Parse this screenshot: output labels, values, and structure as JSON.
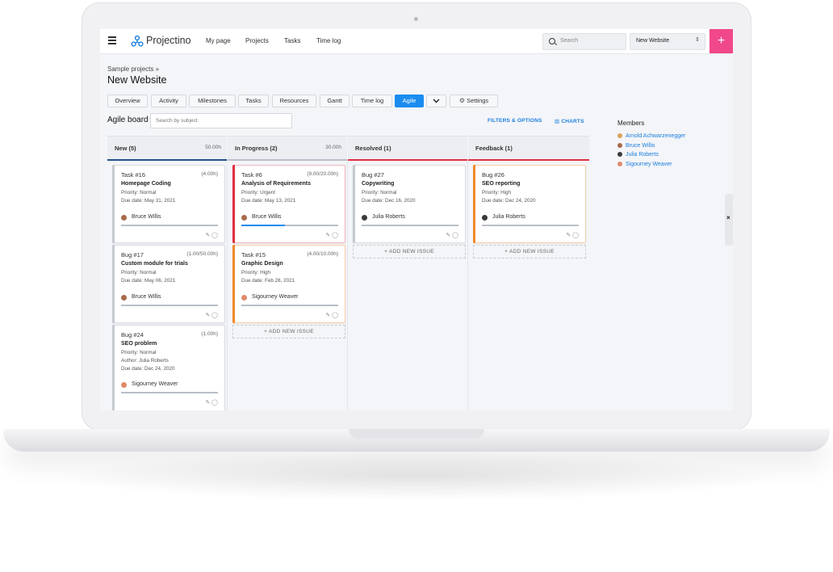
{
  "app": {
    "name": "Projectino"
  },
  "nav": [
    "My page",
    "Projects",
    "Tasks",
    "Time log"
  ],
  "search": {
    "placeholder": "Search"
  },
  "project_select": {
    "value": "New Website"
  },
  "breadcrumb": "Sample projects »",
  "page_title": "New Website",
  "tabs": [
    "Overview",
    "Activity",
    "Milestones",
    "Tasks",
    "Resources",
    "Gantt",
    "Time log",
    "Agile"
  ],
  "settings_label": "Settings",
  "agile": {
    "title": "Agile board",
    "search_placeholder": "Search by subject",
    "filters_label": "FILTERS & OPTIONS",
    "charts_label": "CHARTS",
    "add_new_label": "+ ADD NEW ISSUE"
  },
  "columns": [
    {
      "name": "New (5)",
      "hours": "50.00h",
      "accent": "#1f4f8a"
    },
    {
      "name": "In Progress (2)",
      "hours": "30.00h",
      "accent": "#b9bec8"
    },
    {
      "name": "Resolved (1)",
      "hours": "",
      "accent": "#e02f44"
    },
    {
      "name": "Feedback (1)",
      "hours": "",
      "accent": "#e02f44"
    }
  ],
  "cards": {
    "c16": {
      "title": "Task #16",
      "est": "(4.00h)",
      "subject": "Homepage Coding",
      "line1": "Priority: Normal",
      "line2": "Due date: May 31, 2021",
      "assignee": "Bruce Willis"
    },
    "c17": {
      "title": "Bug #17",
      "est": "(1.00/50.00h)",
      "subject": "Custom module for trials",
      "line1": "Priority: Normal",
      "line2": "Due date: May 06, 2021",
      "assignee": "Bruce Willis"
    },
    "c24": {
      "title": "Bug #24",
      "est": "(1.00h)",
      "subject": "SEO problem",
      "line1": "Priority: Normal",
      "line2": "Author: Julia Roberts",
      "line3": "Due date: Dec 24, 2020",
      "assignee": "Sigourney Weaver"
    },
    "c6": {
      "title": "Task #6",
      "est": "(9.00/20.00h)",
      "subject": "Analysis of Requirements",
      "line1": "Priority: Urgent",
      "line2": "Due date: May 13, 2021",
      "assignee": "Bruce Willis"
    },
    "c15": {
      "title": "Task #15",
      "est": "(4.00/10.00h)",
      "subject": "Graphic Design",
      "line1": "Priority: High",
      "line2": "Due date: Feb 28, 2021",
      "assignee": "Sigourney Weaver"
    },
    "c27": {
      "title": "Bug #27",
      "est": "",
      "subject": "Copywriting",
      "line1": "Priority: Normal",
      "line2": "Due date: Dec 16, 2020",
      "assignee": "Julia Roberts"
    },
    "c26": {
      "title": "Bug #26",
      "est": "",
      "subject": "SEO reporting",
      "line1": "Priority: High",
      "line2": "Due date: Dec 24, 2020",
      "assignee": "Julia Roberts"
    }
  },
  "members": {
    "title": "Members",
    "list": [
      "Arnold Achwarzenegger",
      "Bruce Willis",
      "Julia Roberts",
      "Sigourney Weaver"
    ]
  },
  "colors": {
    "accent": "#1a8cf0",
    "plus": "#f0488a",
    "urgent": "#e02f44",
    "high": "#f08a2c"
  }
}
